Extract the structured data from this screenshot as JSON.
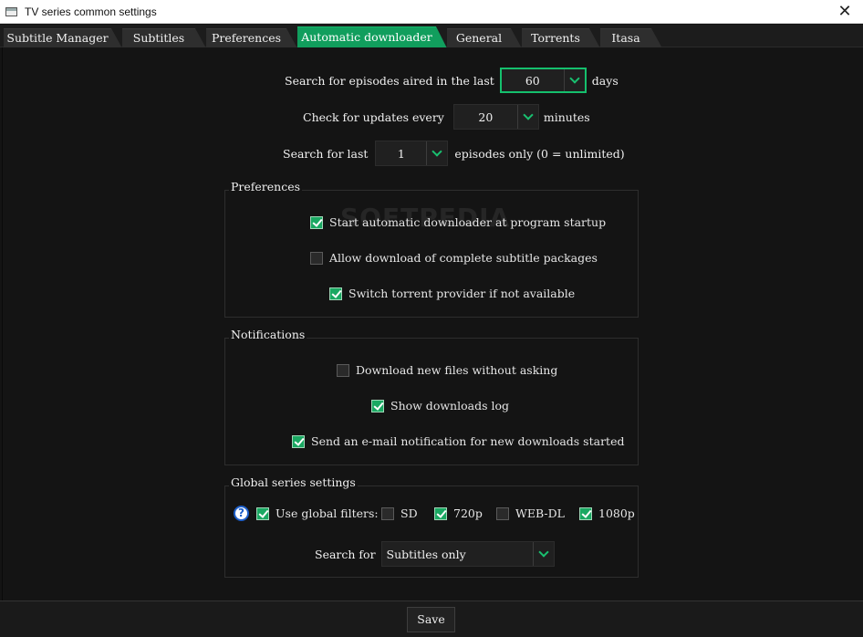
{
  "window": {
    "title": "TV series common settings",
    "close_glyph": "✕"
  },
  "tabs": [
    {
      "label": "Subtitle Manager"
    },
    {
      "label": "Subtitles"
    },
    {
      "label": "Preferences"
    },
    {
      "label": "Automatic downloader",
      "active": true
    },
    {
      "label": "General"
    },
    {
      "label": "Torrents"
    },
    {
      "label": "Itasa"
    }
  ],
  "search": {
    "aired_label": "Search for episodes aired in the last",
    "aired_value": "60",
    "aired_unit": "days",
    "updates_label": "Check for updates every",
    "updates_value": "20",
    "updates_unit": "minutes",
    "last_label": "Search for last",
    "last_value": "1",
    "last_unit": "episodes only (0 = unlimited)"
  },
  "preferences": {
    "title": "Preferences",
    "items": [
      {
        "label": "Start automatic downloader at program startup",
        "checked": true
      },
      {
        "label": "Allow download of complete subtitle packages",
        "checked": false
      },
      {
        "label": "Switch torrent provider if not available",
        "checked": true
      }
    ]
  },
  "notifications": {
    "title": "Notifications",
    "items": [
      {
        "label": "Download new files without asking",
        "checked": false
      },
      {
        "label": "Show downloads log",
        "checked": true
      },
      {
        "label": "Send an e-mail notification for new downloads started",
        "checked": true
      }
    ]
  },
  "global": {
    "title": "Global series settings",
    "help_glyph": "?",
    "use_filters": {
      "label": "Use global filters:",
      "checked": true
    },
    "filters": [
      {
        "label": "SD",
        "checked": false
      },
      {
        "label": "720p",
        "checked": true
      },
      {
        "label": "WEB-DL",
        "checked": false
      },
      {
        "label": "1080p",
        "checked": true
      }
    ],
    "search_for_label": "Search for",
    "search_for_value": "Subtitles only"
  },
  "footer": {
    "save_label": "Save"
  },
  "watermark": "SOFTPEDIA",
  "colors": {
    "accent": "#119e5d",
    "focus": "#15c06d"
  }
}
